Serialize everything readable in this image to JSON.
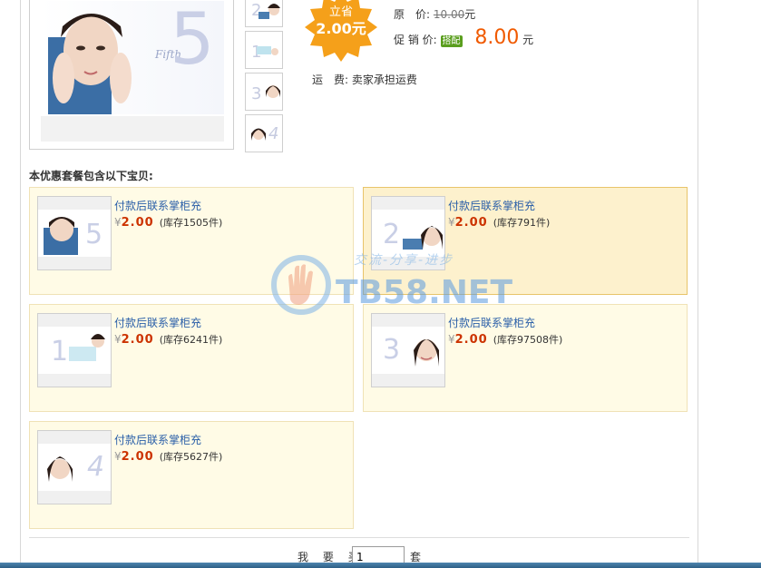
{
  "savings_badge": {
    "line1": "立省",
    "line2": "2.00元"
  },
  "price_info": {
    "original_label": "原　价:",
    "original_price": "10.00",
    "original_unit": "元",
    "promo_label": "促 销 价:",
    "promo_tag": "搭配",
    "promo_price": "8.00",
    "promo_unit": "元",
    "shipping_label": "运　费:",
    "shipping_value": "卖家承担运费"
  },
  "main_image": {
    "script_text": "Fifth",
    "number": "5"
  },
  "thumbnails": [
    {
      "number": "2"
    },
    {
      "number": "1"
    },
    {
      "number": "3"
    },
    {
      "number": "4"
    }
  ],
  "package": {
    "heading": "本优惠套餐包含以下宝贝:",
    "items": [
      {
        "title": "付款后联系掌柜充",
        "currency": "¥",
        "price": "2.00",
        "stock": "(库存1505件)",
        "image_number": "5",
        "selected": false
      },
      {
        "title": "付款后联系掌柜充",
        "currency": "¥",
        "price": "2.00",
        "stock": "(库存791件)",
        "image_number": "2",
        "selected": true
      },
      {
        "title": "付款后联系掌柜充",
        "currency": "¥",
        "price": "2.00",
        "stock": "(库存6241件)",
        "image_number": "1",
        "selected": false
      },
      {
        "title": "付款后联系掌柜充",
        "currency": "¥",
        "price": "2.00",
        "stock": "(库存97508件)",
        "image_number": "3",
        "selected": false
      },
      {
        "title": "付款后联系掌柜充",
        "currency": "¥",
        "price": "2.00",
        "stock": "(库存5627件)",
        "image_number": "4",
        "selected": false
      }
    ]
  },
  "watermark": {
    "slogan": "交流-分享-进步",
    "site": "TB58.NET"
  },
  "purchase": {
    "label": "我 要 买:",
    "quantity": "1",
    "unit": "套"
  },
  "colors": {
    "accent_price": "#f05a00",
    "link": "#2a5fa8",
    "card_bg": "#fffbe6",
    "card_selected_bg": "#fdf1cd",
    "badge": "#f5a01a"
  }
}
